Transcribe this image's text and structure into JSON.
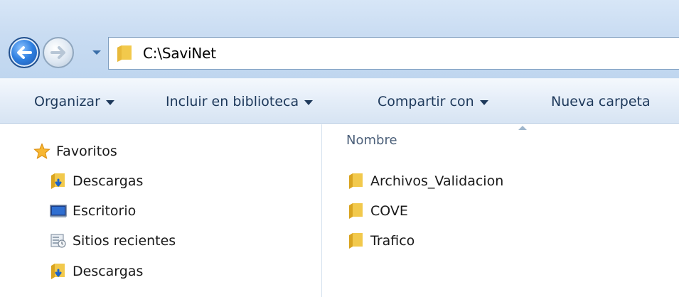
{
  "address_bar": {
    "path": "C:\\SaviNet"
  },
  "toolbar": {
    "organize_label": "Organizar",
    "include_library_label": "Incluir en biblioteca",
    "share_label": "Compartir con",
    "new_folder_label": "Nueva carpeta"
  },
  "nav_pane": {
    "favorites_label": "Favoritos",
    "items": [
      {
        "label": "Descargas",
        "icon": "downloads-folder-icon"
      },
      {
        "label": "Escritorio",
        "icon": "desktop-icon"
      },
      {
        "label": "Sitios recientes",
        "icon": "recent-places-icon"
      },
      {
        "label": "Descargas",
        "icon": "downloads-folder-icon"
      }
    ]
  },
  "content": {
    "column_name": "Nombre",
    "sort": "ascending",
    "files": [
      {
        "name": "Archivos_Validacion",
        "icon": "folder-icon"
      },
      {
        "name": "COVE",
        "icon": "folder-icon"
      },
      {
        "name": "Trafico",
        "icon": "folder-icon"
      }
    ]
  },
  "colors": {
    "title_bar": "#c9dcf2",
    "command_bar": "#e4edf8",
    "command_text": "#1e395b",
    "folder_yellow": "#f2c94c",
    "back_button": "#2e7fe0"
  }
}
